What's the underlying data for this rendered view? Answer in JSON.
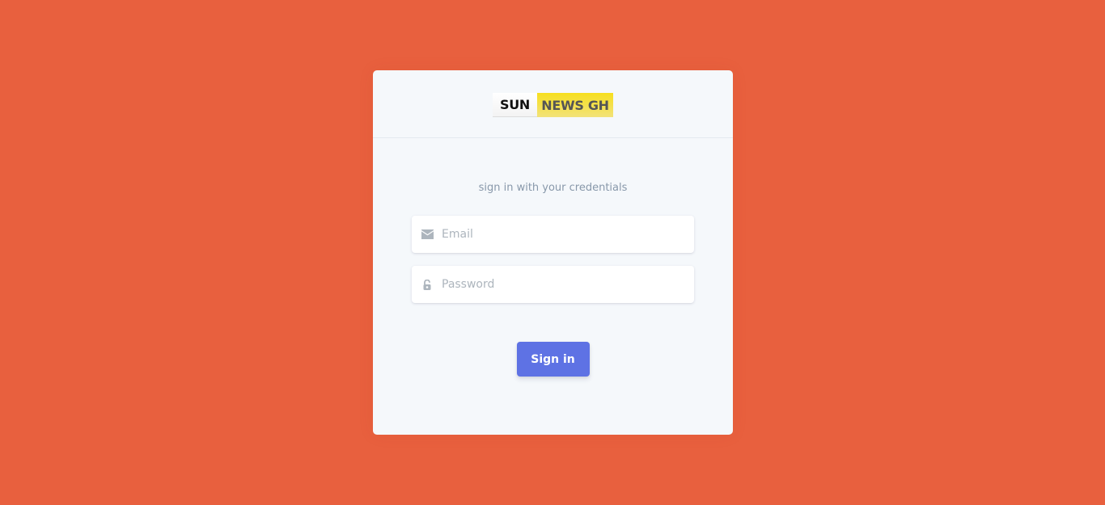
{
  "logo": {
    "left_text": "SUN",
    "right_text": "NEWS GH"
  },
  "login": {
    "subtitle": "sign in with your credentials",
    "email": {
      "placeholder": "Email",
      "value": "",
      "icon": "envelope-icon"
    },
    "password": {
      "placeholder": "Password",
      "value": "",
      "icon": "lock-open-icon"
    },
    "submit_label": "Sign in"
  },
  "colors": {
    "background": "#e8603e",
    "card": "#f5f8fb",
    "primary_button": "#5e72e4",
    "logo_yellow": "#f7df1e"
  }
}
